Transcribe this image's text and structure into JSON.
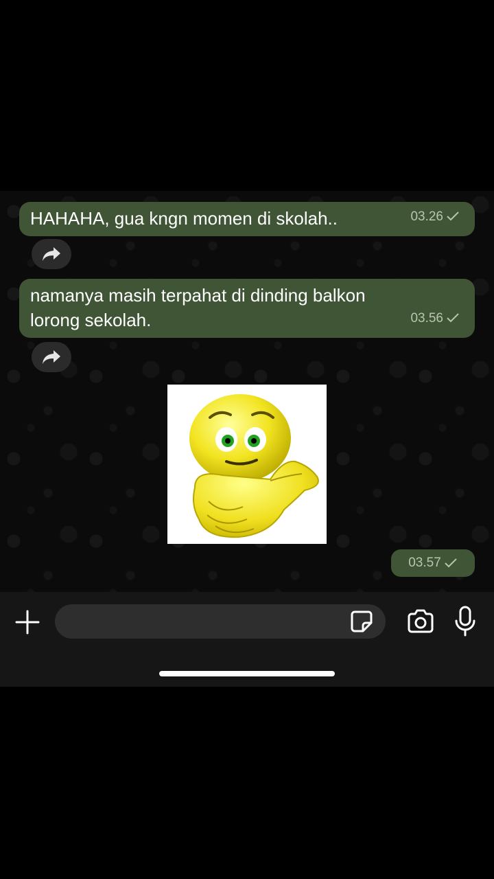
{
  "messages": [
    {
      "text": "HAHAHA, gua kngn momen di skolah..",
      "time": "03.26"
    },
    {
      "text": "namanya masih terpahat di dinding balkon lorong sekolah.",
      "time": "03.56"
    }
  ],
  "sticker": {
    "name": "thumbs-up-smiley-sticker",
    "time": "03.57"
  },
  "input": {
    "placeholder": ""
  },
  "icons": {
    "forward": "forward-arrow-icon",
    "read": "checkmark-icon",
    "add": "plus-icon",
    "sticker": "sticker-icon",
    "camera": "camera-icon",
    "mic": "microphone-icon"
  },
  "colors": {
    "bubble": "#3f5535",
    "background": "#0b0b0b",
    "input_bar": "#161616",
    "timestamp": "#b9c5b1"
  }
}
